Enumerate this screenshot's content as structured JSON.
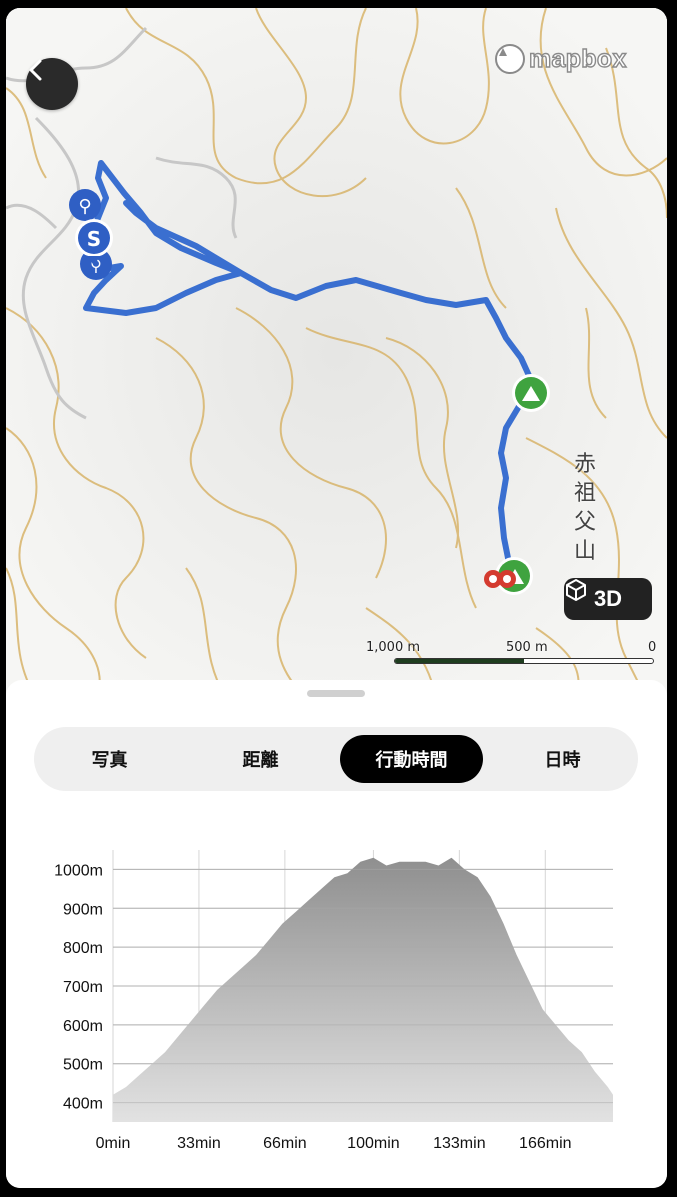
{
  "map": {
    "attribution": "mapbox",
    "place_label": "赤祖父山",
    "button_3d": "3D",
    "scale_labels": [
      "1,000 m",
      "500 m",
      "0"
    ],
    "markers": [
      "hiker-icon",
      "start-icon",
      "summit-icon",
      "viewpoint-icon"
    ],
    "route_color": "#3a6fd0"
  },
  "tabs": [
    {
      "label": "写真",
      "active": false
    },
    {
      "label": "距離",
      "active": false
    },
    {
      "label": "行動時間",
      "active": true
    },
    {
      "label": "日時",
      "active": false
    }
  ],
  "chart_data": {
    "type": "area",
    "title": "",
    "xlabel": "",
    "ylabel": "",
    "x_unit": "min",
    "y_unit": "m",
    "x_ticks": [
      "0min",
      "33min",
      "66min",
      "100min",
      "133min",
      "166min"
    ],
    "y_ticks": [
      "400m",
      "500m",
      "600m",
      "700m",
      "800m",
      "900m",
      "1000m"
    ],
    "xlim": [
      0,
      192
    ],
    "ylim": [
      350,
      1050
    ],
    "x": [
      0,
      5,
      10,
      15,
      20,
      25,
      30,
      35,
      40,
      45,
      50,
      55,
      60,
      65,
      70,
      75,
      80,
      85,
      90,
      95,
      100,
      105,
      110,
      115,
      120,
      125,
      130,
      135,
      140,
      145,
      150,
      155,
      160,
      165,
      170,
      175,
      180,
      185,
      190,
      192
    ],
    "values": [
      420,
      440,
      470,
      500,
      530,
      570,
      610,
      650,
      690,
      720,
      750,
      780,
      820,
      860,
      890,
      920,
      950,
      980,
      990,
      1020,
      1030,
      1010,
      1020,
      1020,
      1020,
      1010,
      1030,
      1000,
      980,
      930,
      860,
      780,
      710,
      640,
      600,
      560,
      530,
      480,
      440,
      420
    ],
    "grid": true,
    "fill": "gray-gradient"
  }
}
